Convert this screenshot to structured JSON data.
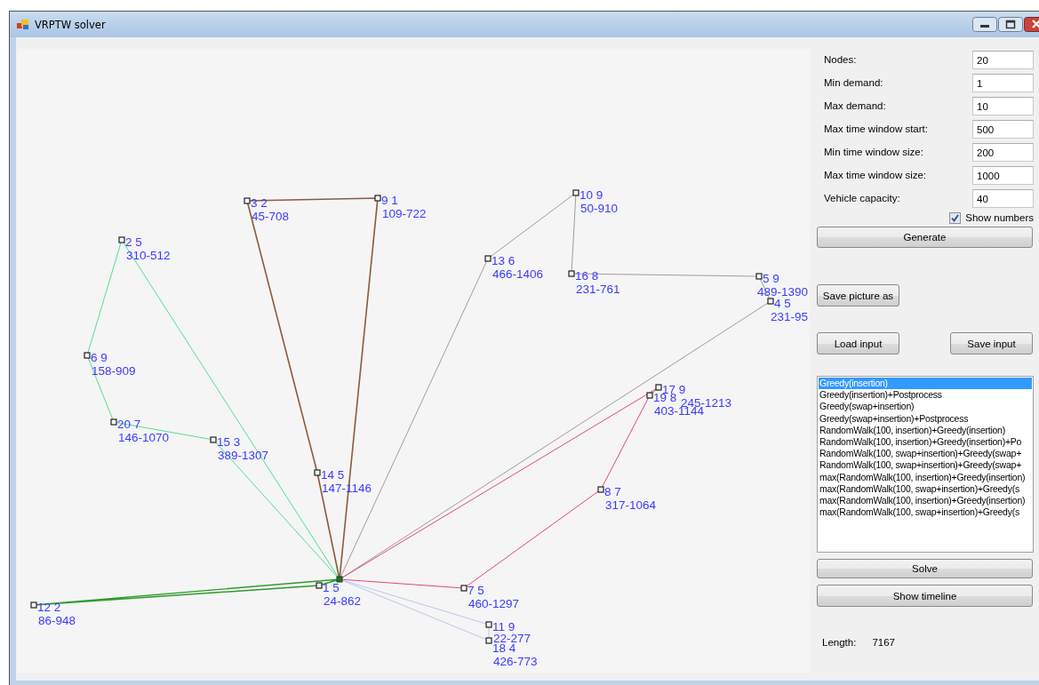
{
  "window": {
    "title": "VRPTW solver"
  },
  "map": {
    "nodes": [
      {
        "label": "3 2",
        "window": "45-708"
      },
      {
        "label": "9 1",
        "window": "109-722"
      },
      {
        "label": "10 9",
        "window": "50-910"
      },
      {
        "label": "2 5",
        "window": "310-512"
      },
      {
        "label": "13 6",
        "window": "466-1406"
      },
      {
        "label": "16 8",
        "window": "231-761"
      },
      {
        "label": "5 9",
        "window": "489-1390"
      },
      {
        "label": "4 5",
        "window": "231-95"
      },
      {
        "label": "6 9",
        "window": "158-909"
      },
      {
        "label": "17 9",
        "window": "245-1213"
      },
      {
        "label": "19 8",
        "window": "403-1144"
      },
      {
        "label": "20 7",
        "window": "146-1070"
      },
      {
        "label": "15 3",
        "window": "389-1307"
      },
      {
        "label": "14 5",
        "window": "147-1146"
      },
      {
        "label": "8 7",
        "window": "317-1064"
      },
      {
        "label": "1 5",
        "window": "24-862"
      },
      {
        "label": "7 5",
        "window": "460-1297"
      },
      {
        "label": "12 2",
        "window": "86-948"
      },
      {
        "label": "11 9",
        "window": "22-277"
      },
      {
        "label": "18 4",
        "window": "426-773"
      }
    ],
    "routes": [
      {
        "color": "#50e090"
      },
      {
        "color": "#8b5a3c"
      },
      {
        "color": "#a89898"
      },
      {
        "color": "#e04a7a"
      },
      {
        "color": "#2e9a2e"
      },
      {
        "color": "#b8c8ec"
      }
    ]
  },
  "settings": [
    {
      "label": "Nodes:",
      "value": "20"
    },
    {
      "label": "Min demand:",
      "value": "1"
    },
    {
      "label": "Max demand:",
      "value": "10"
    },
    {
      "label": "Max time window start:",
      "value": "500"
    },
    {
      "label": "Min time window size:",
      "value": "200"
    },
    {
      "label": "Max time window size:",
      "value": "1000"
    },
    {
      "label": "Vehicle capacity:",
      "value": "40"
    }
  ],
  "show_numbers": {
    "label": "Show numbers",
    "checked": true
  },
  "generate_button": "Generate",
  "save_picture_button": "Save picture as",
  "load_input_button": "Load input",
  "save_input_button": "Save input",
  "algorithms": [
    {
      "label": "Greedy(insertion)",
      "selected": true
    },
    {
      "label": "Greedy(insertion)+Postprocess",
      "selected": false
    },
    {
      "label": "Greedy(swap+insertion)",
      "selected": false
    },
    {
      "label": "Greedy(swap+insertion)+Postprocess",
      "selected": false
    },
    {
      "label": "RandomWalk(100, insertion)+Greedy(insertion)",
      "selected": false
    },
    {
      "label": "RandomWalk(100, insertion)+Greedy(insertion)+Po",
      "selected": false
    },
    {
      "label": "RandomWalk(100, swap+insertion)+Greedy(swap+",
      "selected": false
    },
    {
      "label": "RandomWalk(100, swap+insertion)+Greedy(swap+",
      "selected": false
    },
    {
      "label": "max(RandomWalk(100, insertion)+Greedy(insertion)",
      "selected": false
    },
    {
      "label": "max(RandomWalk(100, swap+insertion)+Greedy(s",
      "selected": false
    },
    {
      "label": "max(RandomWalk(100, insertion)+Greedy(insertion)",
      "selected": false
    },
    {
      "label": "max(RandomWalk(100, swap+insertion)+Greedy(s",
      "selected": false
    }
  ],
  "solve_button": "Solve",
  "timeline_button": "Show timeline",
  "length": {
    "label": "Length:",
    "value": "7167"
  }
}
